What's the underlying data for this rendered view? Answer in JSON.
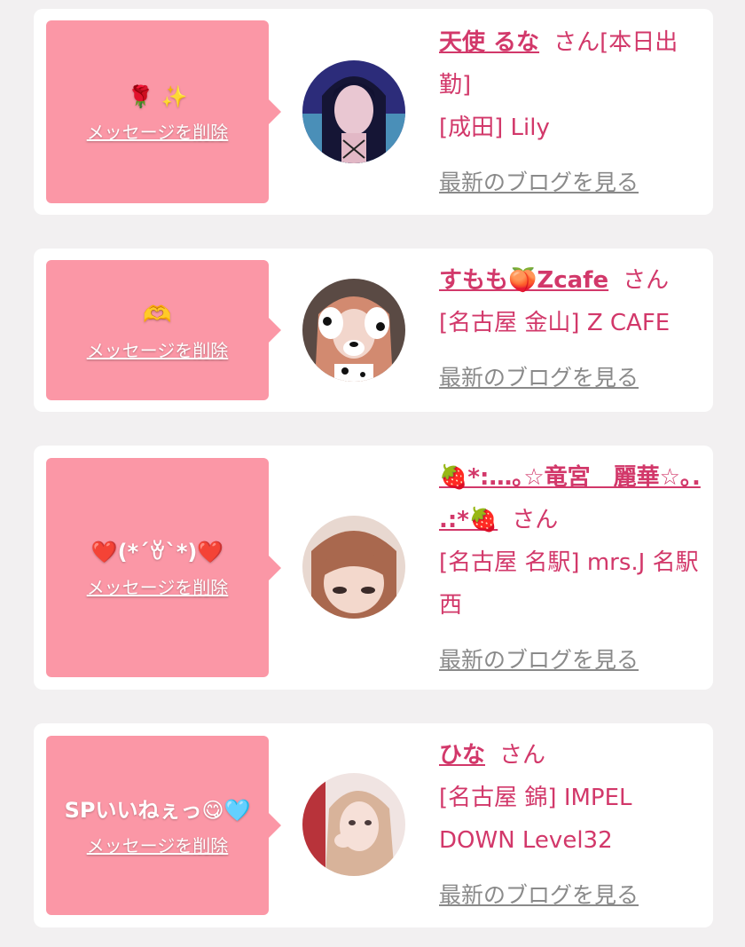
{
  "delete_label": "メッセージを削除",
  "blog_label": "最新のブログを見る",
  "honorific": "さん",
  "colors": {
    "bubble": "#fb97a6",
    "accent": "#d2386a",
    "link_gray": "#8a8a8a"
  },
  "items": [
    {
      "message": "🌹 ✨",
      "name": "天使 るな",
      "suffix": "[本日出勤]",
      "shop": "[成田] Lily",
      "avatar": "girl-with-long-dark-hair"
    },
    {
      "message": "🫶",
      "name": "すもも🍑Zcafe",
      "suffix": "",
      "shop": "[名古屋 金山] Z CAFE",
      "avatar": "girl-with-dog-filter"
    },
    {
      "message": "❤️(*´ꈊ`*)❤️",
      "name": "🍓*:…｡☆竜宮　麗華☆｡. .:*🍓",
      "suffix": "",
      "shop": "[名古屋 名駅] mrs.J 名駅西",
      "avatar": "girl-with-bangs"
    },
    {
      "message": "SPいいねぇっ😋🩵",
      "name": "ひな",
      "suffix": "",
      "shop": "[名古屋 錦] IMPEL DOWN Level32",
      "avatar": "girl-with-blonde-hair"
    }
  ]
}
